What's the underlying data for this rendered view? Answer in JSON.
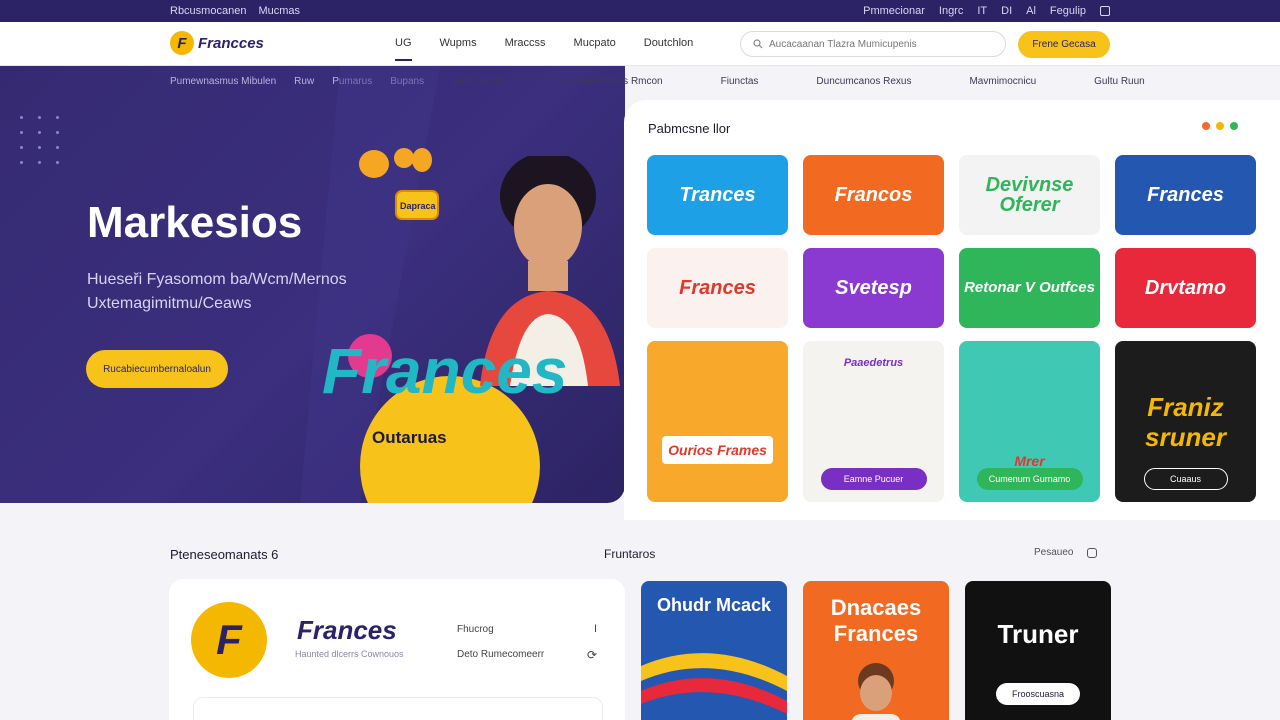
{
  "topbar": {
    "left_links": [
      "Rbcusmocanen",
      "Mucmas"
    ],
    "right_links": [
      "Pmmecionar",
      "Ingrc",
      "IT",
      "DI",
      "Al",
      "Fegulip"
    ]
  },
  "header": {
    "logo_text": "Francces",
    "logo_letter": "F",
    "nav": [
      "UG",
      "Wupms",
      "Mraccss",
      "Mucpato",
      "Doutchlon"
    ],
    "search_placeholder": "Aucacaanan Tlazra Mumicupenis",
    "cta": "Frene Gecasa"
  },
  "subnav": {
    "left": [
      "Pumewnasmus Mibulen",
      "Ruw",
      "Pumarus",
      "Bupans"
    ],
    "right": [
      "Hurt Lurnut",
      "Pausfeemciras Rmcon",
      "Fiunctas",
      "Duncumcanos Rexus",
      "Mavmimocnicu",
      "Gultu Ruun"
    ]
  },
  "hero": {
    "title": "Markesios",
    "description": "Hueseři Fyasomom ba/Wcm/Mernos Uxtemagimitmu/Ceaws",
    "button": "Rucabiecumbernaloalun",
    "brand_text": "Frances",
    "brand_sub": "Outaruas",
    "sticky_note": "Dapraca"
  },
  "panel": {
    "title": "Pabmcsne llor",
    "dot_colors": [
      "#f36a2d",
      "#f5b800",
      "#2fb55a"
    ]
  },
  "cards": [
    {
      "text": "Trances",
      "bg": "#1ea0e6",
      "color": "#ffffff"
    },
    {
      "text": "Francos",
      "bg": "#f26a21",
      "color": "#ffffff"
    },
    {
      "text": "Devivnse Oferer",
      "bg": "#f3f3f3",
      "color": "#2fb55a"
    },
    {
      "text": "Frances",
      "bg": "#2457b0",
      "color": "#ffffff"
    },
    {
      "text": "Frances",
      "bg": "#fbf1ee",
      "color": "#e0392b"
    },
    {
      "text": "Svetesp",
      "bg": "#8b3ad1",
      "color": "#ffffff"
    },
    {
      "text": "Retonar V Outfces",
      "bg": "#2fb55a",
      "color": "#ffffff"
    },
    {
      "text": "Drvtamo",
      "bg": "#e8283b",
      "color": "#ffffff"
    },
    {
      "text": "Ourios Frames",
      "bg": "#f8a82a",
      "color": "#e0392b",
      "pill": ""
    },
    {
      "text": "Paaedetrus",
      "bg": "#f5f3ef",
      "color": "#7a2fc4",
      "pill": "Eamne Pucuer"
    },
    {
      "text": "Mrer",
      "bg": "#3fc9b4",
      "color": "#ffffff",
      "pill": "Cumenum Gurnamo"
    },
    {
      "text": "Franiz sruner",
      "bg": "#1c1c1c",
      "color": "#f5b800",
      "pill": "Cuaaus"
    }
  ],
  "bottom": {
    "heading_left": "Pteneseomanats 6",
    "heading_mid": "Fruntaros",
    "right_ctrl": "Pesaueo",
    "profile": {
      "letter": "F",
      "name": "Frances",
      "tagline": "Haunted dlcerrs Cownouos",
      "meta1": "Fhucrog",
      "meta2": "Deto Rumecomeerr",
      "ctrl1": "I",
      "ctrl2": "⟳"
    },
    "cards": [
      {
        "text": "Ohudr Mcack",
        "bg": "#2457b0",
        "color": "#ffffff"
      },
      {
        "text": "Dnacaes Frances",
        "bg": "#f26a21",
        "color": "#ffffff"
      },
      {
        "text": "Truner",
        "bg": "#111111",
        "color": "#ffffff",
        "pill": "Frooscuasna"
      }
    ]
  }
}
